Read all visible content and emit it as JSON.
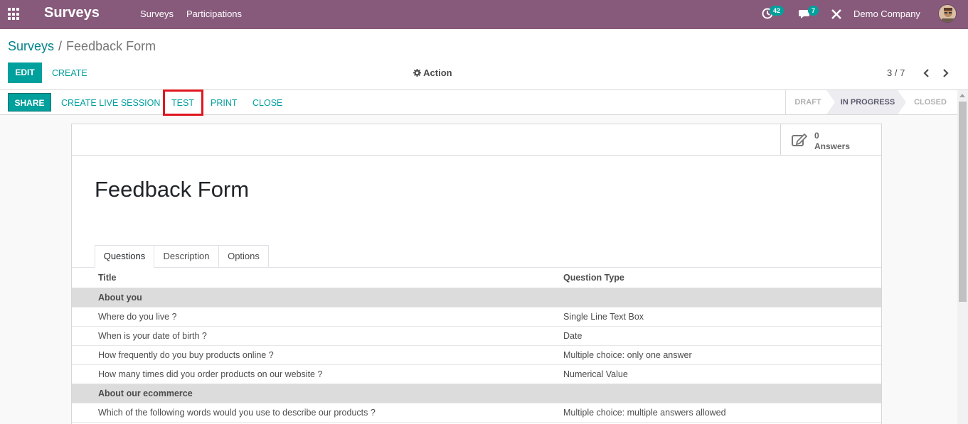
{
  "navbar": {
    "app_name": "Surveys",
    "menus": [
      "Surveys",
      "Participations"
    ],
    "activity_count": "42",
    "messages_count": "7",
    "company": "Demo Company",
    "color": "#875a7b",
    "icons": [
      "apps-grid-icon",
      "activity-clock-icon",
      "chat-icon",
      "close-x-icon",
      "user-avatar"
    ]
  },
  "breadcrumb": {
    "root": "Surveys",
    "separator": "/",
    "current": "Feedback Form"
  },
  "control": {
    "edit_label": "EDIT",
    "create_label": "CREATE",
    "action_label": "Action",
    "pager": "3 / 7"
  },
  "statusbar": {
    "buttons": [
      "SHARE",
      "CREATE LIVE SESSION",
      "TEST",
      "PRINT",
      "CLOSE"
    ],
    "highlighted": "TEST",
    "stages": [
      "DRAFT",
      "IN PROGRESS",
      "CLOSED"
    ],
    "active_stage": "IN PROGRESS"
  },
  "form": {
    "answers_count": "0",
    "answers_label": "Answers",
    "title": "Feedback Form",
    "tabs": [
      "Questions",
      "Description",
      "Options"
    ],
    "active_tab": "Questions",
    "columns": [
      "Title",
      "Question Type"
    ],
    "rows": [
      {
        "title": "About you",
        "type": "",
        "section": true
      },
      {
        "title": "Where do you live ?",
        "type": "Single Line Text Box"
      },
      {
        "title": "When is your date of birth ?",
        "type": "Date"
      },
      {
        "title": "How frequently do you buy products online ?",
        "type": "Multiple choice: only one answer"
      },
      {
        "title": "How many times did you order products on our website ?",
        "type": "Numerical Value"
      },
      {
        "title": "About our ecommerce",
        "type": "",
        "section": true
      },
      {
        "title": "Which of the following words would you use to describe our products ?",
        "type": "Multiple choice: multiple answers allowed"
      }
    ]
  },
  "colors": {
    "accent": "#00a09d",
    "highlight_box": "#e0161f"
  }
}
